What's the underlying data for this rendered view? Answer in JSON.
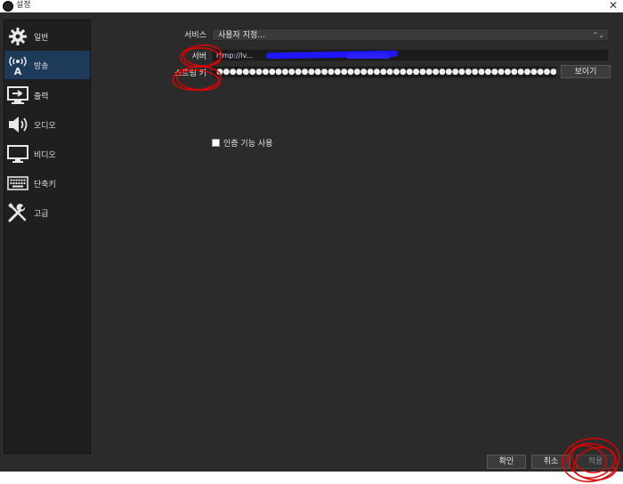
{
  "window": {
    "title": "설정",
    "close_glyph": "✕"
  },
  "sidebar": {
    "items": [
      {
        "label": "일반",
        "icon": "gear-icon"
      },
      {
        "label": "방송",
        "icon": "broadcast-icon",
        "active": true
      },
      {
        "label": "출력",
        "icon": "output-icon"
      },
      {
        "label": "오디오",
        "icon": "speaker-icon"
      },
      {
        "label": "비디오",
        "icon": "monitor-icon"
      },
      {
        "label": "단축키",
        "icon": "keyboard-icon"
      },
      {
        "label": "고급",
        "icon": "tools-icon"
      }
    ]
  },
  "stream": {
    "service_label": "서비스",
    "service_value": "사용자 지정...",
    "server_label": "서버",
    "server_value": "rtmp://lv...",
    "key_label": "스트림 키",
    "key_value": "●●●●●●●●●●●●●●●●●●●●●●●●●●●●●●●●●●●●●●●●●●●●●●●●●●●●●●●●●●●●",
    "show_button": "보이기",
    "auth_label": "인증 기능 사용"
  },
  "footer": {
    "ok": "확인",
    "cancel": "취소",
    "apply": "적용"
  },
  "colors": {
    "background": "#2b2b2b",
    "sidebar": "#1f1f1f",
    "active_item": "#1e3a5a",
    "annotation": "#e00000",
    "redaction": "#1f16ff"
  }
}
